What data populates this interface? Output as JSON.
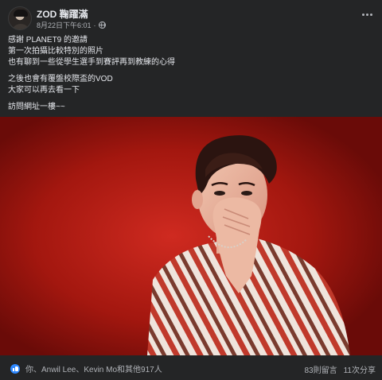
{
  "post": {
    "author": "ZOD 鞠躍滿",
    "timestamp": "8月22日下午6:01",
    "separator": "·",
    "privacy_icon": "globe-icon",
    "caption": {
      "line1": "感謝 PLANET9 的邀請",
      "line2": "第一次拍攝比較特別的照片",
      "line3": "也有聊到一些從學生選手到賽評再到教練的心得",
      "line4": "之後也會有覆盤校際盃的VOD",
      "line5": "大家可以再去看一下",
      "line6": "訪問網址一樓~~"
    }
  },
  "footer": {
    "reaction_icon": "like-icon",
    "reactions_text": "你、Anwil Lee、Kevin Mo和其他917人",
    "comments": "83則留言",
    "shares": "11次分享"
  },
  "colors": {
    "background": "#242526",
    "text_primary": "#e4e6eb",
    "text_secondary": "#b0b3b8",
    "photo_red": "#9e1711",
    "like_blue": "#2d88ff"
  }
}
